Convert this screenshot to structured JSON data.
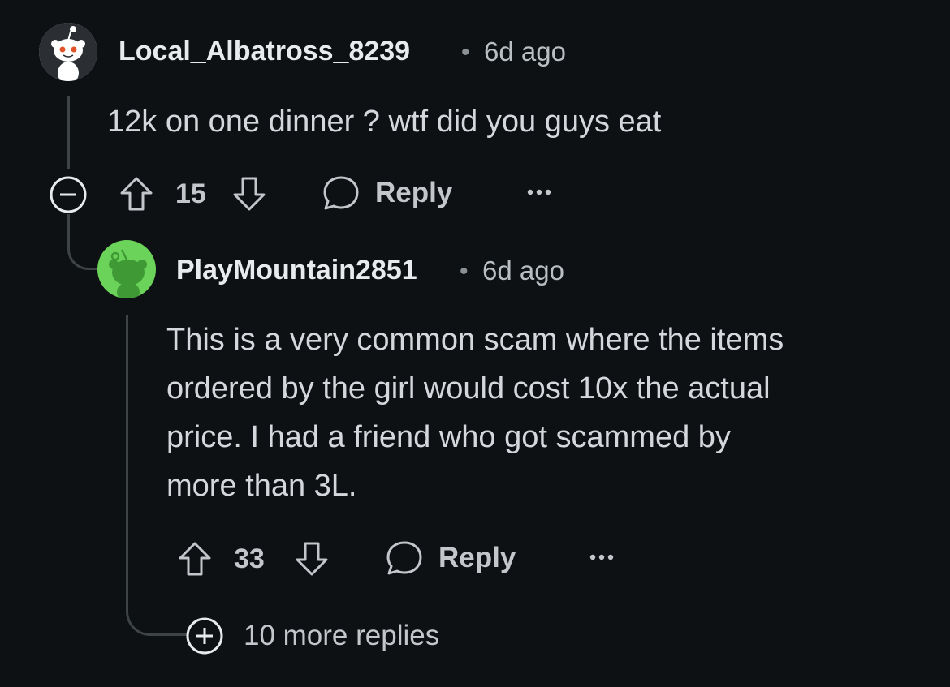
{
  "comments": [
    {
      "username": "Local_Albatross_8239",
      "separator": "•",
      "time": "6d ago",
      "text": "12k on one dinner ? wtf did you guys eat",
      "votes": "15",
      "reply_label": "Reply",
      "avatar_icon": "snoo-avatar-icon"
    },
    {
      "username": "PlayMountain2851",
      "separator": "•",
      "time": "6d ago",
      "text_lines": [
        "This is a very common scam where the items",
        "ordered by the girl would cost 10x the actual",
        "price. I had a friend who got scammed by",
        "more than 3L."
      ],
      "votes": "33",
      "reply_label": "Reply",
      "avatar_icon": "snoo-avatar-icon",
      "avatar_color": "#6bd35a"
    }
  ],
  "more_replies": "10 more replies",
  "colors": {
    "background": "#0e1113",
    "thread_line": "#3e4346",
    "text": "#d4d8dc"
  }
}
